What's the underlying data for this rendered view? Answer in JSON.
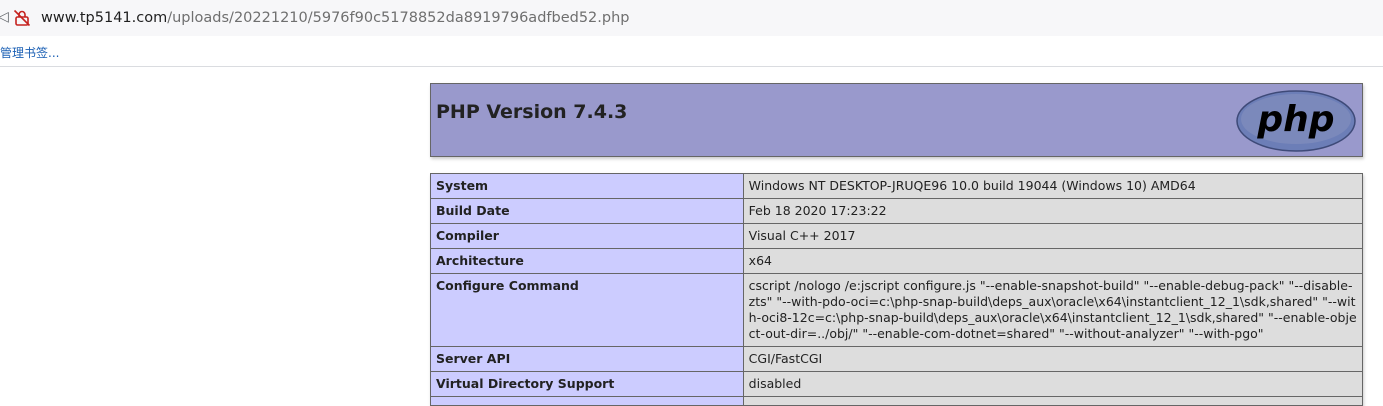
{
  "browser": {
    "url_host": "www.tp5141.com",
    "url_path": "/uploads/20221210/5976f90c5178852da8919796adfbed52.php",
    "nav_fragment": "ツ",
    "bookmark_label": "管理书签..."
  },
  "colors": {
    "header_bg": "#9999cc",
    "key_cell_bg": "#ccccff",
    "value_cell_bg": "#dddddd",
    "border": "#666666"
  },
  "phpinfo": {
    "title": "PHP Version 7.4.3",
    "logo_text": "php",
    "rows": [
      {
        "key": "System",
        "value": "Windows NT DESKTOP-JRUQE96 10.0 build 19044 (Windows 10) AMD64"
      },
      {
        "key": "Build Date",
        "value": "Feb 18 2020 17:23:22"
      },
      {
        "key": "Compiler",
        "value": "Visual C++ 2017"
      },
      {
        "key": "Architecture",
        "value": "x64"
      },
      {
        "key": "Configure Command",
        "value": "cscript /nologo /e:jscript configure.js \"--enable-snapshot-build\" \"--enable-debug-pack\" \"--disable-zts\" \"--with-pdo-oci=c:\\php-snap-build\\deps_aux\\oracle\\x64\\instantclient_12_1\\sdk,shared\" \"--with-oci8-12c=c:\\php-snap-build\\deps_aux\\oracle\\x64\\instantclient_12_1\\sdk,shared\" \"--enable-object-out-dir=../obj/\" \"--enable-com-dotnet=shared\" \"--without-analyzer\" \"--with-pgo\""
      },
      {
        "key": "Server API",
        "value": "CGI/FastCGI"
      },
      {
        "key": "Virtual Directory Support",
        "value": "disabled"
      },
      {
        "key": "",
        "value": ""
      }
    ]
  }
}
